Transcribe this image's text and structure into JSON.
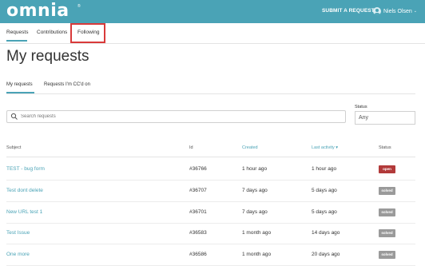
{
  "header": {
    "logo": "omnia",
    "logo_mark": "®",
    "submit_label": "SUBMIT A REQUEST",
    "user_name": "Niels Olsen",
    "chevron": "⌄"
  },
  "subnav": {
    "tabs": [
      {
        "label": "Requests"
      },
      {
        "label": "Contributions"
      },
      {
        "label": "Following"
      }
    ]
  },
  "page_title": "My requests",
  "inner_tabs": [
    {
      "label": "My requests"
    },
    {
      "label": "Requests I'm CC'd on"
    }
  ],
  "search": {
    "placeholder": "Search requests"
  },
  "status_filter": {
    "label": "Status",
    "value": "Any"
  },
  "table": {
    "headers": {
      "subject": "Subject",
      "id": "Id",
      "created": "Created",
      "last_activity": "Last activity ▾",
      "status": "Status"
    },
    "rows": [
      {
        "subject": "TEST - bug form",
        "id": "#36766",
        "created": "1 hour ago",
        "last_activity": "1 hour ago",
        "status": "open"
      },
      {
        "subject": "Test dont delete",
        "id": "#36707",
        "created": "7 days ago",
        "last_activity": "5 days ago",
        "status": "solved"
      },
      {
        "subject": "New URL test 1",
        "id": "#36701",
        "created": "7 days ago",
        "last_activity": "5 days ago",
        "status": "solved"
      },
      {
        "subject": "Test Issue",
        "id": "#36583",
        "created": "1 month ago",
        "last_activity": "14 days ago",
        "status": "solved"
      },
      {
        "subject": "One more",
        "id": "#36586",
        "created": "1 month ago",
        "last_activity": "20 days ago",
        "status": "solved"
      }
    ]
  },
  "colors": {
    "brand": "#4aa3b6",
    "open": "#b23a3a",
    "solved": "#9a9a9a",
    "highlight": "#d93a3a"
  }
}
